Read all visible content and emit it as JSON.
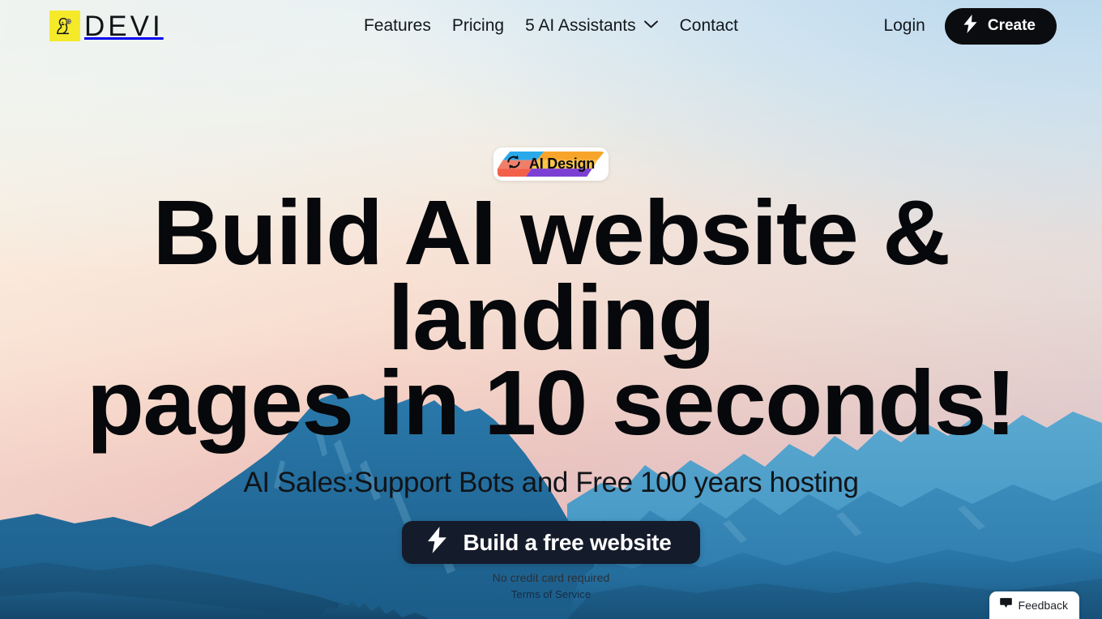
{
  "brand": {
    "name": "DEVI",
    "logo_icon": "woman-profile-icon",
    "logo_bg": "#f5ea2a"
  },
  "nav": {
    "items": [
      {
        "label": "Features",
        "icon": null
      },
      {
        "label": "Pricing",
        "icon": null
      },
      {
        "label": "5 AI Assistants",
        "icon": "chevron-down-icon"
      },
      {
        "label": "Contact",
        "icon": null
      }
    ]
  },
  "header_actions": {
    "login_label": "Login",
    "create_label": "Create",
    "create_icon": "lightning-bolt-icon",
    "create_bg": "#0b0c0f"
  },
  "hero": {
    "badge": {
      "label": "AI Design",
      "icon": "refresh-sync-icon",
      "art_colors": [
        "#29a9e9",
        "#f7a52a",
        "#f07f6a",
        "#fbc54a",
        "#f2604a",
        "#7b3fd4"
      ]
    },
    "headline_line1": "Build AI website & landing",
    "headline_line2": "pages in 10 seconds!",
    "subheadline": "AI Sales:Support Bots and Free 100 years hosting",
    "cta_label": "Build a free website",
    "cta_icon": "lightning-bolt-icon",
    "cta_bg": "#141b2b",
    "cta_note": "No credit card required",
    "terms_label": "Terms of Service"
  },
  "feedback": {
    "label": "Feedback",
    "icon": "chat-bubble-icon"
  },
  "theme": {
    "sky_top": "#c9e0f0",
    "sky_mid": "#f7dccf",
    "sky_bottom": "#dcb2b6",
    "mountain_front": "#1c6190",
    "mountain_mid": "#2a7fb4",
    "mountain_back": "#4fa0cc",
    "text_dark": "#06080b"
  }
}
